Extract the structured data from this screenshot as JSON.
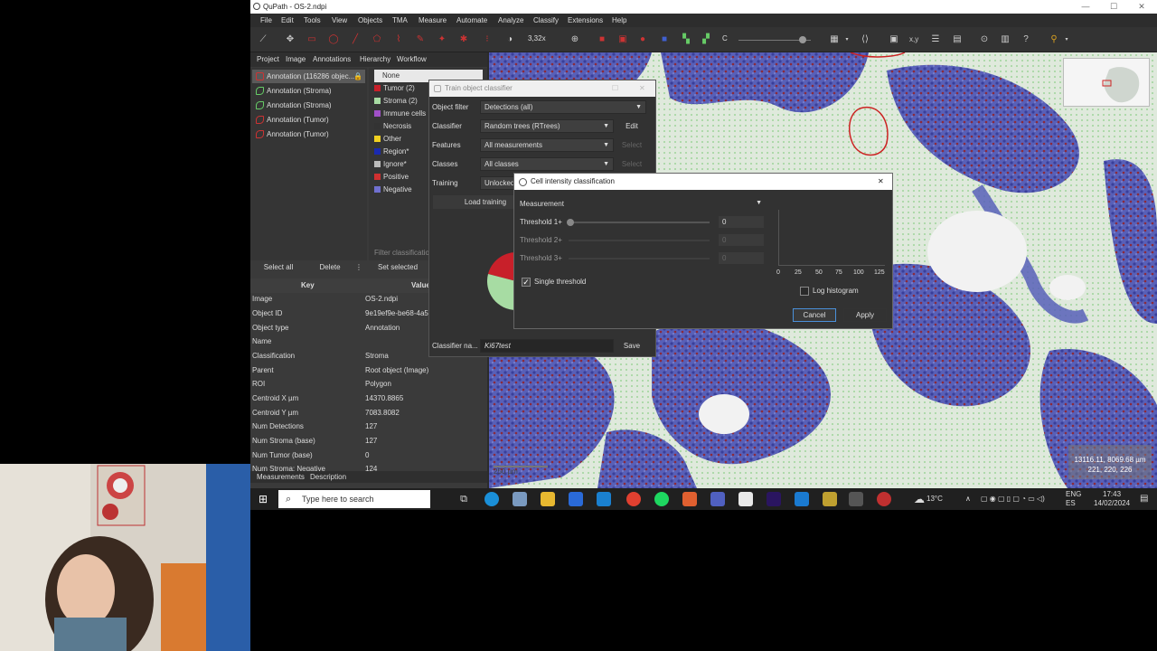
{
  "window": {
    "title": "QuPath - OS-2.ndpi",
    "minimize": "—",
    "maximize": "☐",
    "close": "✕"
  },
  "menu": [
    "File",
    "Edit",
    "Tools",
    "View",
    "Objects",
    "TMA",
    "Measure",
    "Automate",
    "Analyze",
    "Classify",
    "Extensions",
    "Help"
  ],
  "toolbar": {
    "zoom": "3,32x",
    "c_label": "C",
    "xy_label": "x,y"
  },
  "left_tabs": [
    "Project",
    "Image",
    "Annotations",
    "Hierarchy",
    "Workflow"
  ],
  "annotations": [
    {
      "label": "Annotation (116286 objec...",
      "icon": "red"
    },
    {
      "label": "Annotation (Stroma)",
      "icon": "green"
    },
    {
      "label": "Annotation (Stroma)",
      "icon": "green"
    },
    {
      "label": "Annotation (Tumor)",
      "icon": "red"
    },
    {
      "label": "Annotation (Tumor)",
      "icon": "red"
    }
  ],
  "classes": [
    {
      "label": "None",
      "color": "#e8e8e8"
    },
    {
      "label": "Tumor (2)",
      "color": "#c8202a"
    },
    {
      "label": "Stroma (2)",
      "color": "#a7dca3"
    },
    {
      "label": "Immune cells",
      "color": "#a050c8"
    },
    {
      "label": "Necrosis",
      "color": "#333333"
    },
    {
      "label": "Other",
      "color": "#f0d020"
    },
    {
      "label": "Region*",
      "color": "#1a2ab0"
    },
    {
      "label": "Ignore*",
      "color": "#bbbbbb"
    },
    {
      "label": "Positive",
      "color": "#d03030"
    },
    {
      "label": "Negative",
      "color": "#7070d0"
    }
  ],
  "class_filter_placeholder": "Filter classification",
  "buttons": {
    "select_all": "Select all",
    "delete": "Delete",
    "more": "⋮",
    "set_selected": "Set selected",
    "more2": "⋮"
  },
  "kv_headers": {
    "key": "Key",
    "value": "Value"
  },
  "properties": [
    {
      "k": "Image",
      "v": "OS-2.ndpi"
    },
    {
      "k": "Object ID",
      "v": "9e19ef9e-be68-4a5"
    },
    {
      "k": "Object type",
      "v": "Annotation"
    },
    {
      "k": "Name",
      "v": ""
    },
    {
      "k": "Classification",
      "v": "Stroma"
    },
    {
      "k": "Parent",
      "v": "Root object (Image)"
    },
    {
      "k": "ROI",
      "v": "Polygon"
    },
    {
      "k": "Centroid X µm",
      "v": "14370.8865"
    },
    {
      "k": "Centroid Y µm",
      "v": "7083.8082"
    },
    {
      "k": "Num Detections",
      "v": "127"
    },
    {
      "k": "Num Stroma (base)",
      "v": "127"
    },
    {
      "k": "Num Tumor (base)",
      "v": "0"
    },
    {
      "k": "Num Stroma: Negative",
      "v": "124"
    }
  ],
  "bottom_tabs": [
    "Measurements",
    "Description"
  ],
  "viewer": {
    "coords_line1": "13116.11, 8069.68 µm",
    "coords_line2": "221, 220, 226",
    "scalebar": "250 µm"
  },
  "train_dialog": {
    "title": "Train object classifier",
    "object_filter_label": "Object filter",
    "object_filter_value": "Detections (all)",
    "classifier_label": "Classifier",
    "classifier_value": "Random trees (RTrees)",
    "edit": "Edit",
    "features_label": "Features",
    "features_value": "All measurements",
    "select1": "Select",
    "classes_label": "Classes",
    "classes_value": "All classes",
    "select2": "Select",
    "training_label": "Training",
    "training_value": "Unlocked",
    "load_training": "Load training",
    "classifier_name_label": "Classifier na...",
    "classifier_name_value": "Ki67test",
    "save": "Save"
  },
  "intensity_dialog": {
    "title": "Cell intensity classification",
    "close": "✕",
    "measurement_label": "Measurement",
    "t1_label": "Threshold 1+",
    "t1_value": "0",
    "t2_label": "Threshold 2+",
    "t2_value": "0",
    "t3_label": "Threshold 3+",
    "t3_value": "0",
    "single_threshold": "Single threshold",
    "single_threshold_checked": true,
    "log_histogram": "Log histogram",
    "log_histogram_checked": false,
    "axis_ticks": [
      "0",
      "25",
      "50",
      "75",
      "100",
      "125"
    ],
    "cancel": "Cancel",
    "apply": "Apply"
  },
  "taskbar": {
    "search_placeholder": "Type here to search",
    "weather": "13°C",
    "lang1": "ENG",
    "lang2": "ES",
    "time": "17:43",
    "date": "14/02/2024"
  }
}
